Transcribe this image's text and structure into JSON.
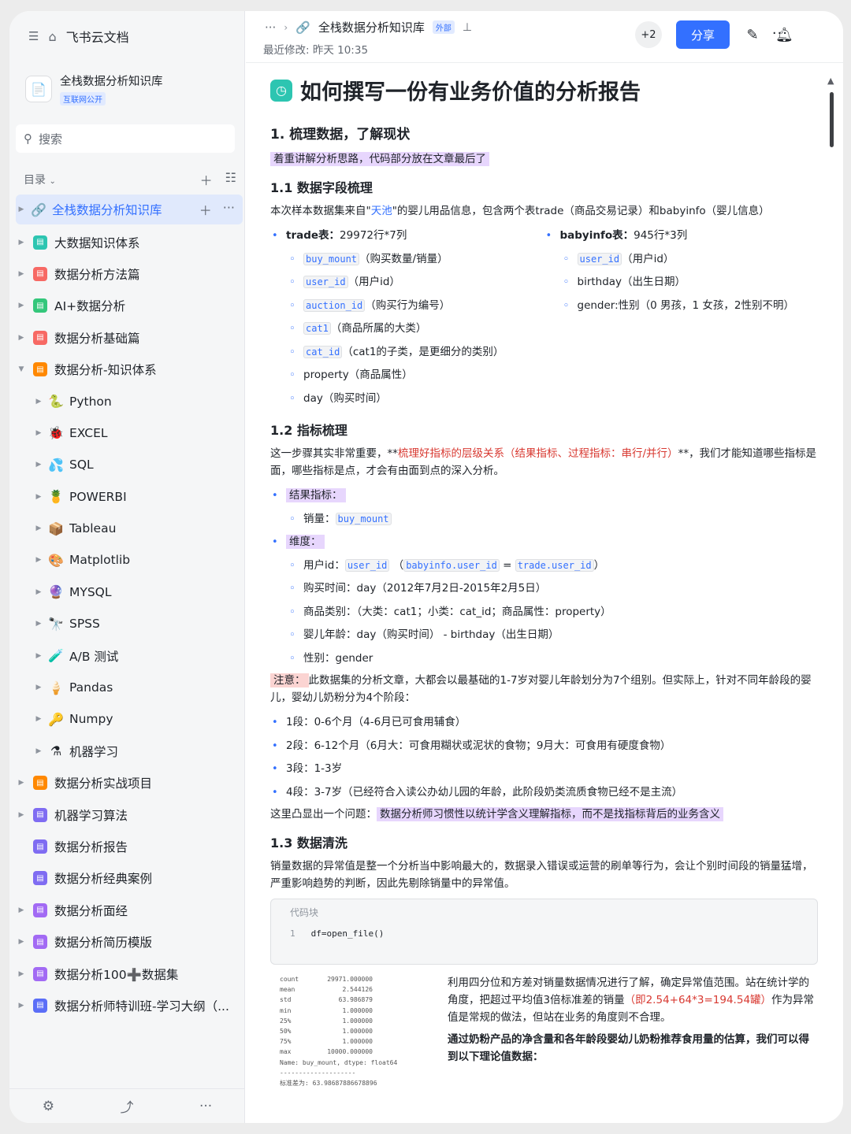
{
  "sidebar": {
    "app_title": "飞书云文档",
    "space_title": "全栈数据分析知识库",
    "space_badge": "互联网公开",
    "search_placeholder": "搜索",
    "toc_label": "目录",
    "items": [
      {
        "label": "全栈数据分析知识库",
        "icon": "link-icon",
        "active": true
      },
      {
        "label": "大数据知识体系",
        "icon": "doc-icon",
        "color": "#2dc5b1"
      },
      {
        "label": "数据分析方法篇",
        "icon": "doc-icon",
        "color": "#f76964"
      },
      {
        "label": "AI+数据分析",
        "icon": "doc-icon",
        "color": "#34c77b"
      },
      {
        "label": "数据分析基础篇",
        "icon": "doc-icon",
        "color": "#f76964"
      },
      {
        "label": "数据分析-知识体系",
        "icon": "doc-icon",
        "color": "#ff8800",
        "expanded": true
      },
      {
        "label": "Python",
        "emoji": "🐍",
        "child": true
      },
      {
        "label": "EXCEL",
        "emoji": "🐞",
        "child": true
      },
      {
        "label": "SQL",
        "emoji": "💦",
        "child": true
      },
      {
        "label": "POWERBI",
        "emoji": "🍍",
        "child": true
      },
      {
        "label": "Tableau",
        "emoji": "📦",
        "child": true
      },
      {
        "label": "Matplotlib",
        "emoji": "🎨",
        "child": true
      },
      {
        "label": "MYSQL",
        "emoji": "🔮",
        "child": true
      },
      {
        "label": "SPSS",
        "emoji": "🔭",
        "child": true
      },
      {
        "label": "A/B 测试",
        "emoji": "🧪",
        "child": true
      },
      {
        "label": "Pandas",
        "emoji": "🍦",
        "child": true
      },
      {
        "label": "Numpy",
        "emoji": "🔑",
        "child": true
      },
      {
        "label": "机器学习",
        "emoji": "⚗",
        "child": true
      },
      {
        "label": "数据分析实战项目",
        "icon": "doc-icon",
        "color": "#ff8800"
      },
      {
        "label": "机器学习算法",
        "icon": "doc-icon",
        "color": "#7f6cf2"
      },
      {
        "label": "数据分析报告",
        "icon": "doc-icon",
        "color": "#7f6cf2",
        "no_caret": true
      },
      {
        "label": "数据分析经典案例",
        "icon": "doc-icon",
        "color": "#7f6cf2",
        "no_caret": true
      },
      {
        "label": "数据分析面经",
        "icon": "doc-icon",
        "color": "#a26af4"
      },
      {
        "label": "数据分析简历模版",
        "icon": "doc-icon",
        "color": "#a26af4"
      },
      {
        "label": "数据分析100➕数据集",
        "icon": "doc-icon",
        "color": "#a26af4"
      },
      {
        "label": "数据分析师特训班-学习大纲（...",
        "icon": "doc-icon",
        "color": "#5b6ef7"
      }
    ]
  },
  "header": {
    "crumb_title": "全栈数据分析知识库",
    "external_badge": "外部",
    "modified": "最近修改: 昨天 10:35",
    "collaborators": "+2",
    "share_label": "分享"
  },
  "doc": {
    "title": "如何撰写一份有业务价值的分析报告",
    "s1": "1. 梳理数据，了解现状",
    "s1_note": "着重讲解分析思路，代码部分放在文章最后了",
    "s11": "1.1 数据字段梳理",
    "s11_intro_a": "本次样本数据集来自\"",
    "s11_intro_link": "天池",
    "s11_intro_b": "\"的婴儿用品信息，包含两个表trade（商品交易记录）和babyinfo（婴儿信息）",
    "trade_head": "trade表：",
    "trade_size": "29972行*7列",
    "trade_fields": [
      {
        "code": "buy_mount",
        "desc": "（购买数量/销量）"
      },
      {
        "code": "user_id",
        "desc": "（用户id）"
      },
      {
        "code": "auction_id",
        "desc": "（购买行为编号）"
      },
      {
        "code": "cat1",
        "desc": "（商品所属的大类）"
      },
      {
        "code": "cat_id",
        "desc": "（cat1的子类，是更细分的类别）"
      },
      {
        "code": "",
        "desc": "property（商品属性）"
      },
      {
        "code": "",
        "desc": "day（购买时间）"
      }
    ],
    "baby_head": "babyinfo表：",
    "baby_size": "945行*3列",
    "baby_fields": [
      {
        "code": "user_id",
        "desc": "（用户id）"
      },
      {
        "code": "",
        "desc": "birthday（出生日期）"
      },
      {
        "code": "",
        "desc": "gender:性别（0 男孩，1 女孩，2性别不明）"
      }
    ],
    "s12": "1.2 指标梳理",
    "s12_p_a": "这一步骤其实非常重要，**",
    "s12_p_red": "梳理好指标的层级关系（结果指标、过程指标：串行/并行）",
    "s12_p_b": "**，我们才能知道哪些指标是面，哪些指标是点，才会有由面到点的深入分析。",
    "result_label": "结果指标：",
    "sales_label": "销量：",
    "sales_code": "buy_mount",
    "dim_label": "维度：",
    "dim_user": "用户id：",
    "dim_user_code": "user_id",
    "dim_user_code2": "babyinfo.user_id",
    "dim_user_code3": "trade.user_id",
    "dim_time": "购买时间：day（2012年7月2日-2015年2月5日）",
    "dim_cat": "商品类别：（大类：cat1；小类：cat_id；商品属性：property）",
    "dim_age": "婴儿年龄：day（购买时间） - birthday（出生日期）",
    "dim_gender": "性别：gender",
    "notice_label": "注意：",
    "notice_text": "此数据集的分析文章，大都会以最基础的1-7岁对婴儿年龄划分为7个组别。但实际上，针对不同年龄段的婴儿，婴幼儿奶粉分为4个阶段：",
    "stages": [
      "1段：0-6个月（4-6月已可食用辅食）",
      "2段：6-12个月（6月大：可食用糊状或泥状的食物；9月大：可食用有硬度食物）",
      "3段：1-3岁",
      "4段：3-7岁（已经符合入读公办幼儿园的年龄，此阶段奶类流质食物已经不是主流）"
    ],
    "problem_a": "这里凸显出一个问题：",
    "problem_hl": "数据分析师习惯性以统计学含义理解指标，而不是找指标背后的业务含义",
    "s13": "1.3 数据清洗",
    "s13_p": "销量数据的异常值是整一个分析当中影响最大的，数据录入错误或运营的刷单等行为，会让个别时间段的销量猛增，严重影响趋势的判断，因此先剔除销量中的异常值。",
    "code_label": "代码块",
    "code_line_no": "1",
    "code_line": "df=open_file()",
    "stats": [
      [
        "count",
        "29971.000000"
      ],
      [
        "mean",
        "2.544126"
      ],
      [
        "std",
        "63.986879"
      ],
      [
        "min",
        "1.000000"
      ],
      [
        "25%",
        "1.000000"
      ],
      [
        "50%",
        "1.000000"
      ],
      [
        "75%",
        "1.000000"
      ],
      [
        "max",
        "10000.000000"
      ]
    ],
    "stats_name": "Name: buy_mount, dtype: float64",
    "stats_sep": "--------------------",
    "stats_std": "标准差为: 63.98687886678896",
    "right_p1_a": "利用四分位和方差对销量数据情况进行了解，确定异常值范围。站在统计学的角度，把超过平均值3倍标准差的销量",
    "right_p1_red": "（即2.54+64*3=194.54罐）",
    "right_p1_b": "作为异常值是常规的做法，但站在业务的角度则不合理。",
    "right_p2_a": "通过奶粉产品的净含量和各年龄段婴幼儿奶粉推荐食用量的估算，",
    "right_p2_b": "我们可以得到以下理论值数据："
  }
}
